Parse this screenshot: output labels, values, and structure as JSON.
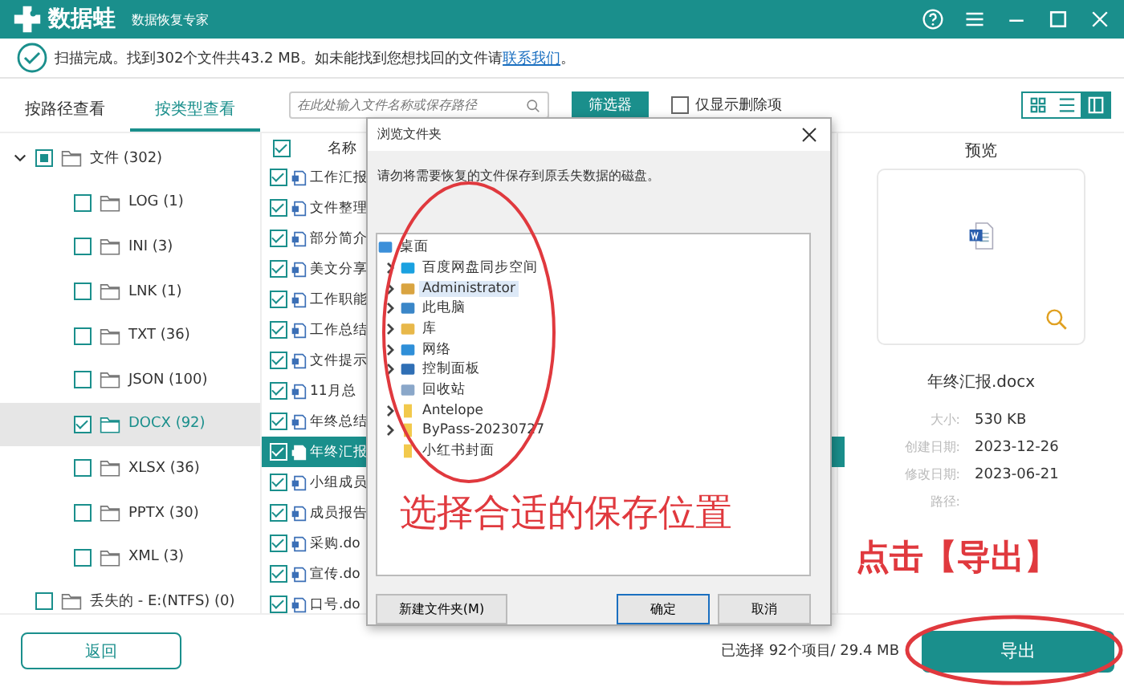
{
  "app": {
    "name": "数据蛙",
    "subtitle": "数据恢复专家"
  },
  "status": {
    "message": "扫描完成。找到302个文件共43.2 MB。如未能找到您想找回的文件请",
    "link": "联系我们",
    "suffix": "。"
  },
  "view_tabs": [
    {
      "label": "按路径查看",
      "selected": false
    },
    {
      "label": "按类型查看",
      "selected": true
    }
  ],
  "search": {
    "placeholder": "在此处输入文件名称或保存路径"
  },
  "filter_button": "筛选器",
  "deleted_only": {
    "label": "仅显示删除项",
    "checked": false
  },
  "view_modes": [
    {
      "kind": "grid",
      "selected": false
    },
    {
      "kind": "list",
      "selected": false
    },
    {
      "kind": "detail",
      "selected": true
    }
  ],
  "tree": [
    {
      "label": "文件 (302)",
      "partial": true,
      "expanded": true,
      "selected": false,
      "children": [
        {
          "label": "LOG (1)",
          "checked": false,
          "selected": false
        },
        {
          "label": "INI (3)",
          "checked": false,
          "selected": false
        },
        {
          "label": "LNK (1)",
          "checked": false,
          "selected": false
        },
        {
          "label": "TXT (36)",
          "checked": false,
          "selected": false
        },
        {
          "label": "JSON (100)",
          "checked": false,
          "selected": false
        },
        {
          "label": "DOCX (92)",
          "checked": true,
          "selected": true
        },
        {
          "label": "XLSX (36)",
          "checked": false,
          "selected": false
        },
        {
          "label": "PPTX (30)",
          "checked": false,
          "selected": false
        },
        {
          "label": "XML (3)",
          "checked": false,
          "selected": false
        }
      ]
    },
    {
      "label": "丢失的 - E:(NTFS) (0)",
      "checked": false,
      "partial": false,
      "selected": false
    }
  ],
  "file_list": {
    "header": "名称",
    "header_checked": true,
    "rows": [
      {
        "name": "工作汇报",
        "checked": true,
        "selected": false
      },
      {
        "name": "文件整理",
        "checked": true,
        "selected": false
      },
      {
        "name": "部分简介",
        "checked": true,
        "selected": false
      },
      {
        "name": "美文分享",
        "checked": true,
        "selected": false
      },
      {
        "name": "工作职能",
        "checked": true,
        "selected": false
      },
      {
        "name": "工作总结",
        "checked": true,
        "selected": false
      },
      {
        "name": "文件提示",
        "checked": true,
        "selected": false
      },
      {
        "name": "11月总",
        "checked": true,
        "selected": false
      },
      {
        "name": "年终总结",
        "checked": true,
        "selected": false
      },
      {
        "name": "年终汇报",
        "checked": true,
        "selected": true
      },
      {
        "name": "小组成员",
        "checked": true,
        "selected": false
      },
      {
        "name": "成员报告",
        "checked": true,
        "selected": false
      },
      {
        "name": "采购.do",
        "checked": true,
        "selected": false
      },
      {
        "name": "宣传.do",
        "checked": true,
        "selected": false
      },
      {
        "name": "口号.do",
        "checked": true,
        "selected": false
      }
    ]
  },
  "preview": {
    "title": "预览",
    "file_name": "年终汇报.docx",
    "details": [
      {
        "label": "大小:",
        "value": "530 KB"
      },
      {
        "label": "创建日期:",
        "value": "2023-12-26"
      },
      {
        "label": "修改日期:",
        "value": "2023-06-21"
      },
      {
        "label": "路径:"
      }
    ]
  },
  "dialog": {
    "title": "浏览文件夹",
    "message": "请勿将需要恢复的文件保存到原丢失数据的磁盘。",
    "folders": [
      {
        "label": "桌面",
        "kind": "desktop",
        "selected": false,
        "top": true
      },
      {
        "label": "百度网盘同步空间",
        "kind": "cloud",
        "expandable": true,
        "selected": false
      },
      {
        "label": "Administrator",
        "kind": "user",
        "expandable": true,
        "selected": true
      },
      {
        "label": "此电脑",
        "kind": "pc",
        "expandable": true,
        "selected": false
      },
      {
        "label": "库",
        "kind": "library",
        "expandable": true,
        "selected": false
      },
      {
        "label": "网络",
        "kind": "network",
        "expandable": true,
        "selected": false
      },
      {
        "label": "控制面板",
        "kind": "control",
        "expandable": true,
        "selected": false
      },
      {
        "label": "回收站",
        "kind": "recycle",
        "expandable": false,
        "selected": false
      },
      {
        "label": "Antelope",
        "kind": "folder",
        "expandable": true,
        "selected": false
      },
      {
        "label": "ByPass-20230727",
        "kind": "folder",
        "expandable": true,
        "selected": false
      },
      {
        "label": "小红书封面",
        "kind": "folder",
        "expandable": false,
        "selected": false
      }
    ],
    "buttons": [
      "新建文件夹(M)",
      "确定",
      "取消"
    ]
  },
  "annotations": [
    "选择合适的保存位置",
    "点击【导出】"
  ],
  "footer": {
    "back": "返回",
    "summary": "已选择 92个项目/ 29.4 MB",
    "export": "导出"
  }
}
